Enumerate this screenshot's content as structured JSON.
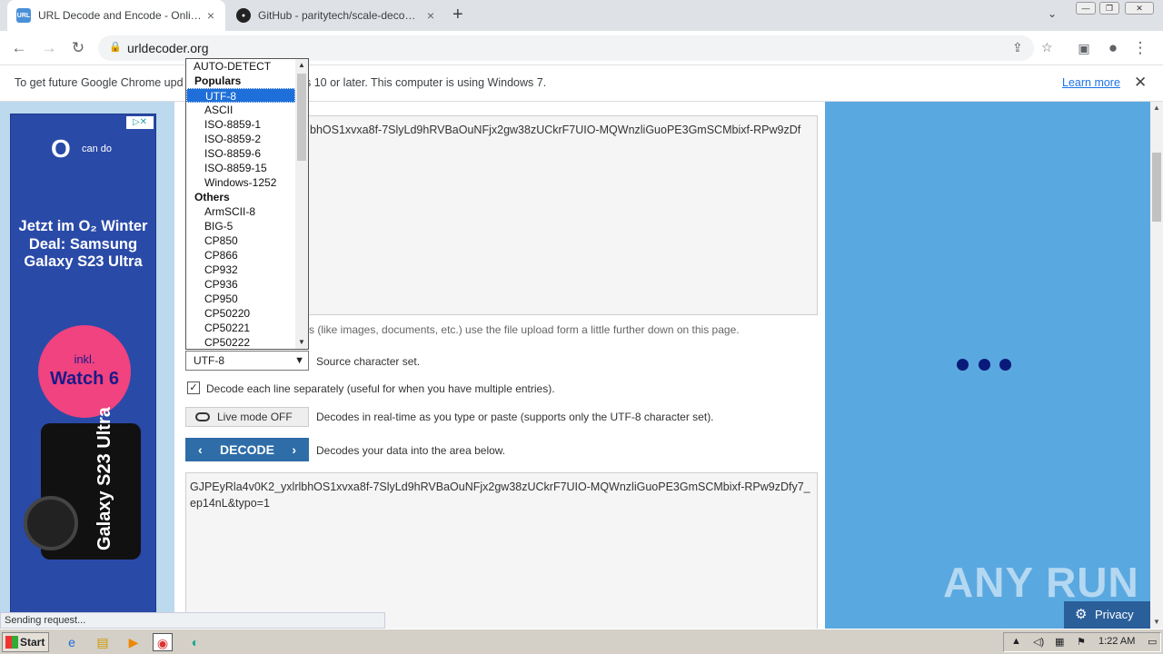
{
  "browser": {
    "tabs": [
      {
        "title": "URL Decode and Encode - Online",
        "favicon": "URL",
        "active": true
      },
      {
        "title": "GitHub - paritytech/scale-decode: De",
        "favicon": "github-icon",
        "active": false
      }
    ],
    "new_tab": "+",
    "address": "urldecoder.org"
  },
  "infobar": {
    "message": "To get future Google Chrome upd... s 10 or later. This computer is using Windows 7.",
    "message_left": "To get future Google Chrome upd",
    "message_right": "s 10 or later. This computer is using Windows 7.",
    "learn_more": "Learn more"
  },
  "left_ad": {
    "brand": "O",
    "brand_sub": "can do",
    "headline": "Jetzt im O₂ Winter Deal: Samsung Galaxy S23 Ultra",
    "badge_top": "inkl.",
    "badge_bottom": "Watch 6",
    "product": "Galaxy S23 Ultra"
  },
  "decoder": {
    "input_text": "bhOS1xvxa8f-7SlyLd9hRVBaOuNFjx2gw38zUCkrF7UIO-MQWnzliGuoPE3GmSCMbixf-RPw9zDf",
    "hint_text": "s (like images, documents, etc.) use the file upload form a little further down on this page.",
    "charset_selected": "UTF-8",
    "charset_label": "Source character set.",
    "decode_lines_label": "Decode each line separately (useful for when you have multiple entries).",
    "live_mode_label": "Live mode OFF",
    "live_mode_desc": "Decodes in real-time as you type or paste (supports only the UTF-8 character set).",
    "decode_button": "DECODE",
    "decode_desc": "Decodes your data into the area below.",
    "output_text": "GJPEyRla4v0K2_yxlrlbhOS1xvxa8f-7SlyLd9hRVBaOuNFjx2gw38zUCkrF7UIO-MQWnzliGuoPE3GmSCMbixf-RPw9zDfy7_ep14nL&typo=1"
  },
  "dropdown": {
    "options": [
      {
        "label": "AUTO-DETECT",
        "kind": "top"
      },
      {
        "label": "Populars",
        "kind": "group"
      },
      {
        "label": "UTF-8",
        "kind": "item",
        "selected": true
      },
      {
        "label": "ASCII",
        "kind": "item"
      },
      {
        "label": "ISO-8859-1",
        "kind": "item"
      },
      {
        "label": "ISO-8859-2",
        "kind": "item"
      },
      {
        "label": "ISO-8859-6",
        "kind": "item"
      },
      {
        "label": "ISO-8859-15",
        "kind": "item"
      },
      {
        "label": "Windows-1252",
        "kind": "item"
      },
      {
        "label": "Others",
        "kind": "group"
      },
      {
        "label": "ArmSCII-8",
        "kind": "item"
      },
      {
        "label": "BIG-5",
        "kind": "item"
      },
      {
        "label": "CP850",
        "kind": "item"
      },
      {
        "label": "CP866",
        "kind": "item"
      },
      {
        "label": "CP932",
        "kind": "item"
      },
      {
        "label": "CP936",
        "kind": "item"
      },
      {
        "label": "CP950",
        "kind": "item"
      },
      {
        "label": "CP50220",
        "kind": "item"
      },
      {
        "label": "CP50221",
        "kind": "item"
      },
      {
        "label": "CP50222",
        "kind": "item"
      }
    ]
  },
  "right_ad": {
    "watermark": "ANY RUN",
    "privacy": "Privacy"
  },
  "status": "Sending request...",
  "taskbar": {
    "start": "Start",
    "time": "1:22 AM"
  },
  "colors": {
    "accent": "#2e6da8",
    "selection": "#1e6fd9",
    "ad_right_bg": "#5aa8e0"
  }
}
